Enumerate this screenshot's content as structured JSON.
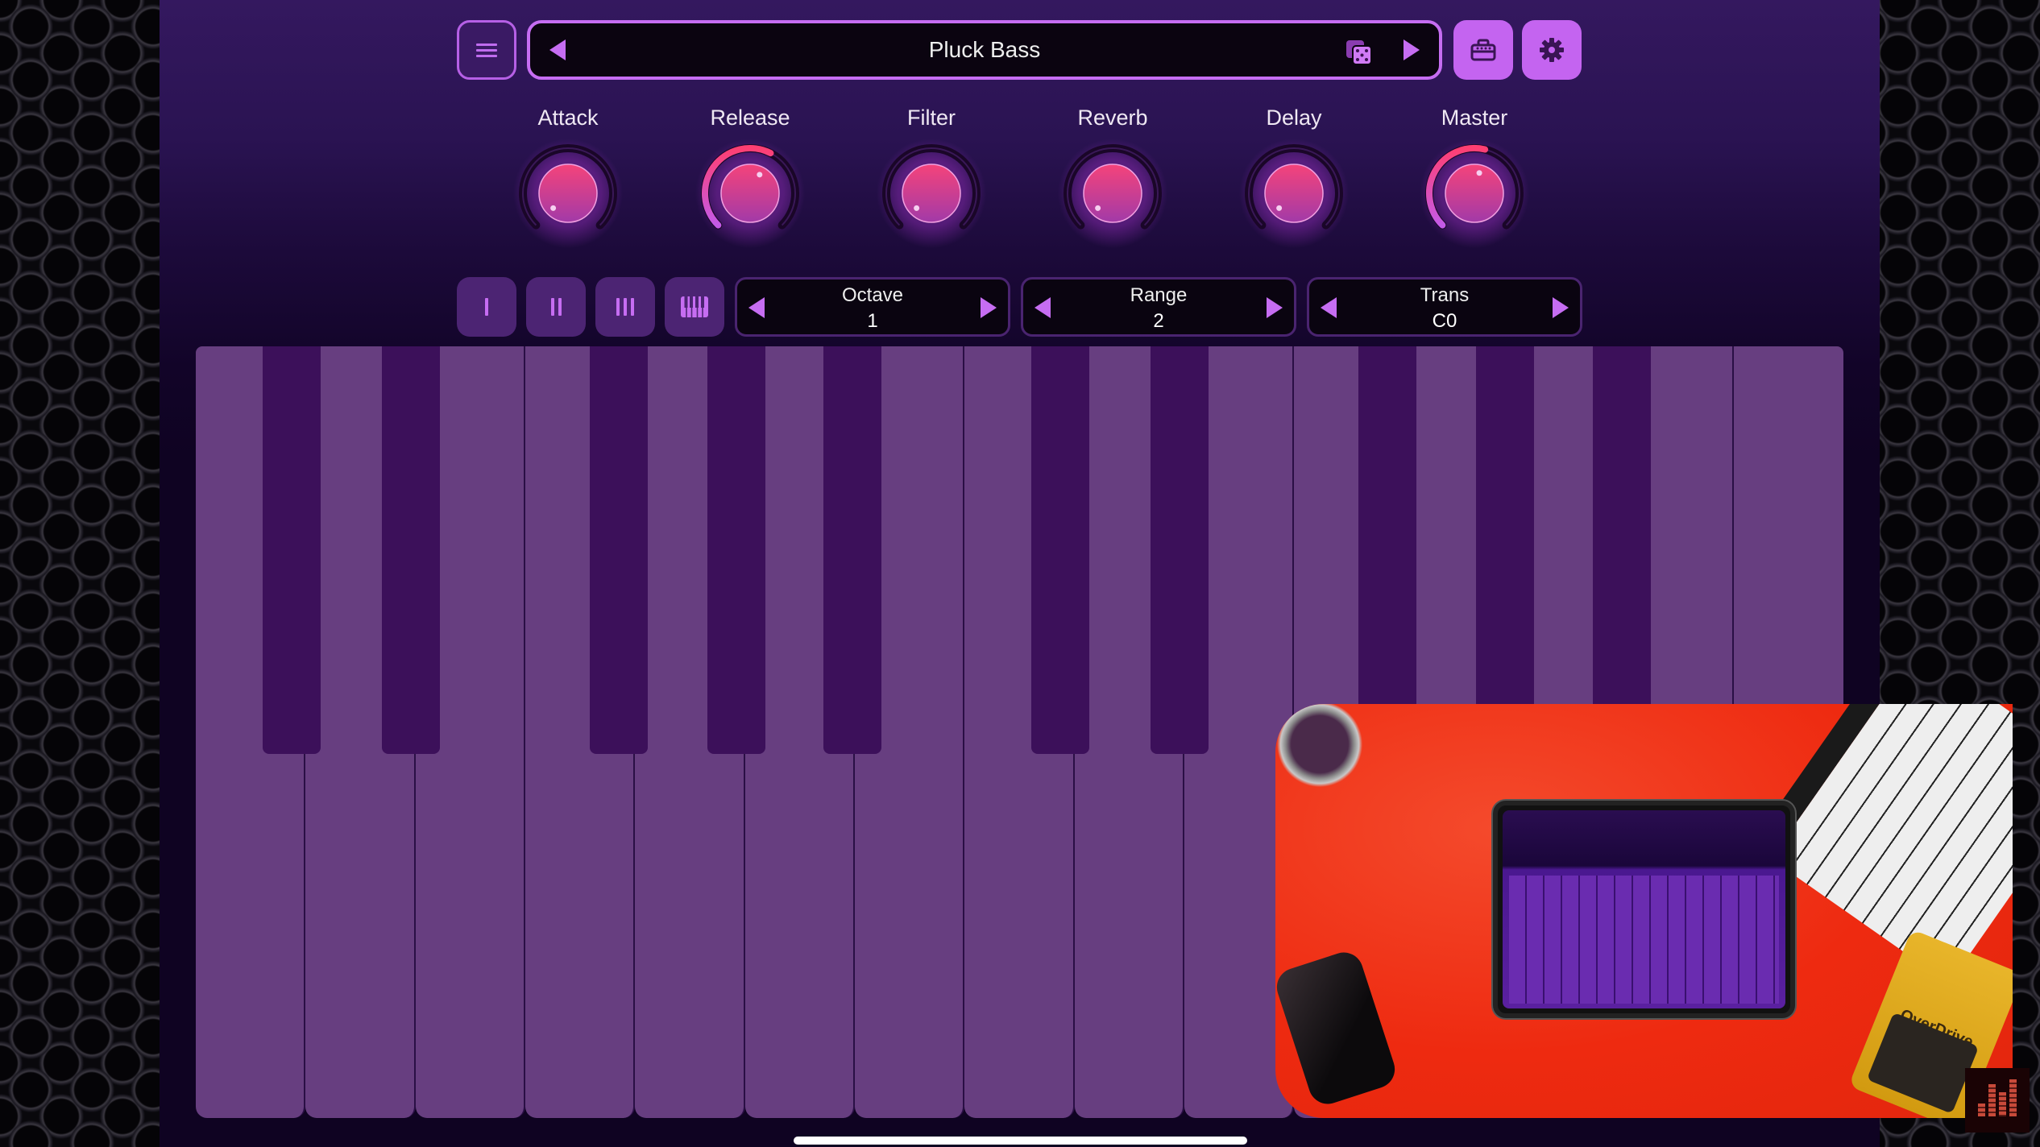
{
  "app": {
    "preset_name": "Pluck Bass",
    "toolbar": {
      "menu_icon": "hamburger-menu-icon",
      "prev_preset_icon": "triangle-left-icon",
      "random_preset_icon": "dice-icon",
      "next_preset_icon": "triangle-right-icon",
      "briefcase_icon": "briefcase-icon",
      "settings_icon": "gear-icon"
    },
    "knobs": [
      {
        "label": "Attack",
        "value": 0.0
      },
      {
        "label": "Release",
        "value": 0.6
      },
      {
        "label": "Filter",
        "value": 0.0
      },
      {
        "label": "Reverb",
        "value": 0.0
      },
      {
        "label": "Delay",
        "value": 0.0
      },
      {
        "label": "Master",
        "value": 0.55
      }
    ],
    "mode_buttons": [
      {
        "name": "mode-1",
        "strokes": 1
      },
      {
        "name": "mode-2",
        "strokes": 2
      },
      {
        "name": "mode-3",
        "strokes": 3
      },
      {
        "name": "keyboard-mode",
        "icon": "piano-icon",
        "selected": true
      }
    ],
    "steppers": [
      {
        "label": "Octave",
        "value": "1"
      },
      {
        "label": "Range",
        "value": "2"
      },
      {
        "label": "Trans",
        "value": "C0"
      }
    ],
    "keyboard": {
      "white_keys": [
        "C",
        "D",
        "E",
        "F",
        "G",
        "A",
        "B",
        "C",
        "D",
        "E",
        "F",
        "G",
        "A",
        "B",
        "C"
      ],
      "black_keys": [
        "C#",
        "D#",
        "F#",
        "G#",
        "A#",
        "C#",
        "D#",
        "F#",
        "G#",
        "A#"
      ]
    },
    "colors": {
      "accent": "#c66df2",
      "knob_pink": "#f0437a",
      "knob_purple": "#b04ab0",
      "white_key": "#673e80",
      "black_key": "#3c105a"
    }
  },
  "overlay": {
    "pip_video": "picture-in-picture-video",
    "pedal_text": "OverDrive",
    "corner_logo_icon": "equalizer-bars-icon"
  }
}
